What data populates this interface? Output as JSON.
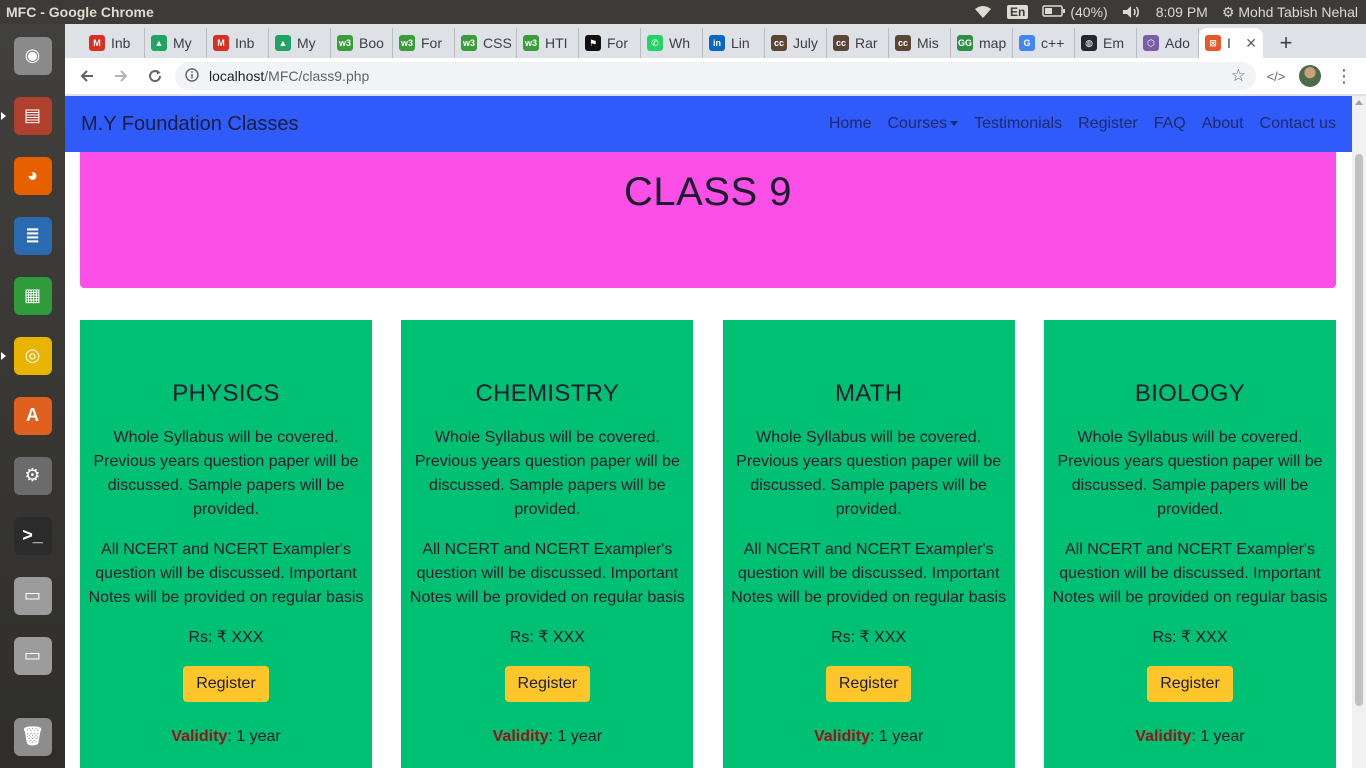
{
  "system": {
    "window_title": "MFC - Google Chrome",
    "keyboard_layout": "En",
    "battery": "(40%)",
    "clock": "8:09 PM",
    "user": "Mohd Tabish Nehal"
  },
  "launcher": {
    "apps": [
      {
        "name": "ubuntu-dash-icon",
        "color": "#8a8a8a",
        "glyph": "◉"
      },
      {
        "name": "files-icon",
        "color": "#b0412e",
        "glyph": "▤"
      },
      {
        "name": "firefox-icon",
        "color": "#e66000",
        "glyph": "◕"
      },
      {
        "name": "writer-icon",
        "color": "#2a6ab1",
        "glyph": "≣"
      },
      {
        "name": "calc-icon",
        "color": "#2f9b3b",
        "glyph": "▦"
      },
      {
        "name": "chrome-icon",
        "color": "#e8b400",
        "glyph": "◎"
      },
      {
        "name": "software-center-icon",
        "color": "#e0611f",
        "glyph": "A"
      },
      {
        "name": "settings-icon",
        "color": "#6b6b6b",
        "glyph": "⚙"
      },
      {
        "name": "terminal-icon",
        "color": "#2b2b2b",
        "glyph": ">_"
      },
      {
        "name": "drive-icon",
        "color": "#9c9c9c",
        "glyph": "▭"
      },
      {
        "name": "drive-icon-2",
        "color": "#9c9c9c",
        "glyph": "▭"
      }
    ],
    "trash": {
      "name": "trash-icon",
      "glyph": "🗑"
    }
  },
  "tabs": [
    {
      "label": "Inb",
      "fav_color": "#d93025",
      "fav": "M"
    },
    {
      "label": "My",
      "fav_color": "#1fa463",
      "fav": "▲"
    },
    {
      "label": "Inb",
      "fav_color": "#d93025",
      "fav": "M"
    },
    {
      "label": "My",
      "fav_color": "#1fa463",
      "fav": "▲"
    },
    {
      "label": "Boo",
      "fav_color": "#3a9c3a",
      "fav": "w3"
    },
    {
      "label": "For",
      "fav_color": "#3a9c3a",
      "fav": "w3"
    },
    {
      "label": "CSS",
      "fav_color": "#3a9c3a",
      "fav": "w3"
    },
    {
      "label": "HTI",
      "fav_color": "#3a9c3a",
      "fav": "w3"
    },
    {
      "label": "For",
      "fav_color": "#111111",
      "fav": "⚑"
    },
    {
      "label": "Wh",
      "fav_color": "#25d366",
      "fav": "✆"
    },
    {
      "label": "Lin",
      "fav_color": "#0a66c2",
      "fav": "in"
    },
    {
      "label": "July",
      "fav_color": "#5b4636",
      "fav": "cc"
    },
    {
      "label": "Rar",
      "fav_color": "#5b4636",
      "fav": "cc"
    },
    {
      "label": "Mis",
      "fav_color": "#5b4636",
      "fav": "cc"
    },
    {
      "label": "map",
      "fav_color": "#2f8d46",
      "fav": "GG"
    },
    {
      "label": "c++",
      "fav_color": "#4285f4",
      "fav": "G"
    },
    {
      "label": "Em",
      "fav_color": "#24292e",
      "fav": "◍"
    },
    {
      "label": "Ado",
      "fav_color": "#7a5ea8",
      "fav": "⬡"
    },
    {
      "label": "I",
      "fav_color": "#e8582b",
      "fav": "⊠",
      "active": true
    }
  ],
  "toolbar": {
    "url_host": "localhost",
    "url_path": "/MFC/class9.php"
  },
  "navbar": {
    "brand": "M.Y Foundation Classes",
    "links": {
      "home": "Home",
      "courses": "Courses",
      "testimonials": "Testimonials",
      "register": "Register",
      "faq": "FAQ",
      "about": "About",
      "contact": "Contact us"
    }
  },
  "hero": {
    "title": "CLASS 9"
  },
  "cards": [
    {
      "title": "PHYSICS",
      "desc1": "Whole Syllabus will be covered. Previous years question paper will be discussed. Sample papers will be provided.",
      "desc2": "All NCERT and NCERT Exampler's question will be discussed. Important Notes will be provided on regular basis",
      "price": "Rs: ₹ XXX",
      "button": "Register",
      "validity_label": "Validity",
      "validity_value": ": 1 year"
    },
    {
      "title": "CHEMISTRY",
      "desc1": "Whole Syllabus will be covered. Previous years question paper will be discussed. Sample papers will be provided.",
      "desc2": "All NCERT and NCERT Exampler's question will be discussed. Important Notes will be provided on regular basis",
      "price": "Rs: ₹ XXX",
      "button": "Register",
      "validity_label": "Validity",
      "validity_value": ": 1 year"
    },
    {
      "title": "MATH",
      "desc1": "Whole Syllabus will be covered. Previous years question paper will be discussed. Sample papers will be provided.",
      "desc2": "All NCERT and NCERT Exampler's question will be discussed. Important Notes will be provided on regular basis",
      "price": "Rs: ₹ XXX",
      "button": "Register",
      "validity_label": "Validity",
      "validity_value": ": 1 year"
    },
    {
      "title": "BIOLOGY",
      "desc1": "Whole Syllabus will be covered. Previous years question paper will be discussed. Sample papers will be provided.",
      "desc2": "All NCERT and NCERT Exampler's question will be discussed. Important Notes will be provided on regular basis",
      "price": "Rs: ₹ XXX",
      "button": "Register",
      "validity_label": "Validity",
      "validity_value": ": 1 year"
    }
  ],
  "colors": {
    "navbar": "#2f5bfa",
    "hero": "#fc4fe8",
    "card": "#00c074",
    "button": "#ffc62c",
    "validity": "#9b1016"
  }
}
